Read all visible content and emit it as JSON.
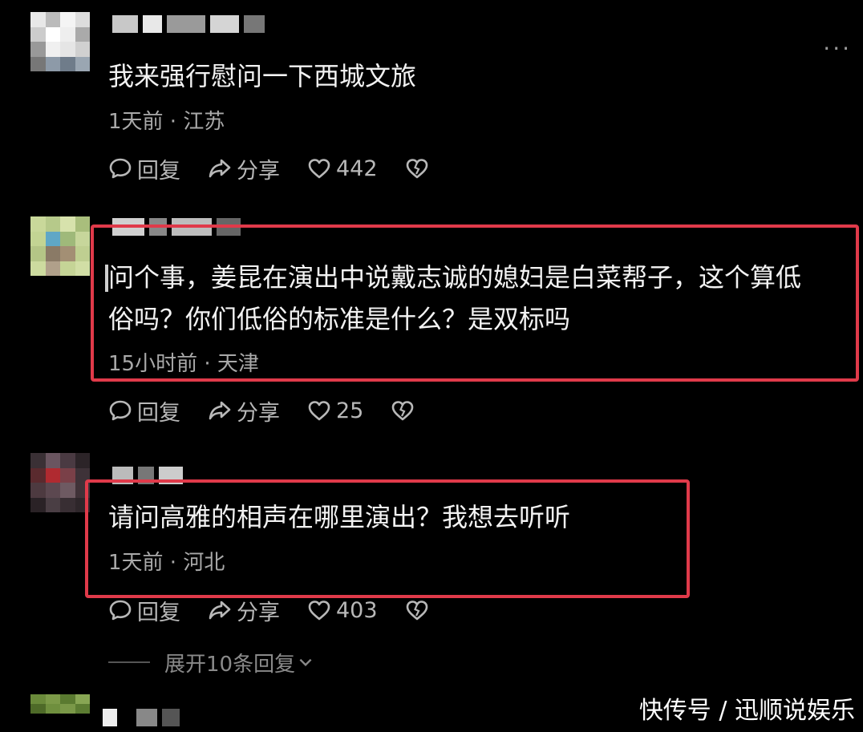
{
  "more_label": "...",
  "comments": [
    {
      "text_lines": [
        "我来强行慰问一下西城文旅"
      ],
      "meta": "1天前 · 江苏",
      "reply_label": "回复",
      "share_label": "分享",
      "like_count": "442"
    },
    {
      "text_lines": [
        "问个事，姜昆在演出中说戴志诚的媳妇是白菜帮子，这个算低",
        "俗吗？你们低俗的标准是什么？是双标吗"
      ],
      "meta": "15小时前 · 天津",
      "reply_label": "回复",
      "share_label": "分享",
      "like_count": "25"
    },
    {
      "text_lines": [
        "请问高雅的相声在哪里演出？我想去听听"
      ],
      "meta": "1天前 · 河北",
      "reply_label": "回复",
      "share_label": "分享",
      "like_count": "403"
    }
  ],
  "expand_label": "展开10条回复",
  "watermark": "快传号 / 迅顺说娱乐",
  "colors": {
    "highlight": "#e03a4a",
    "background": "#000000"
  }
}
